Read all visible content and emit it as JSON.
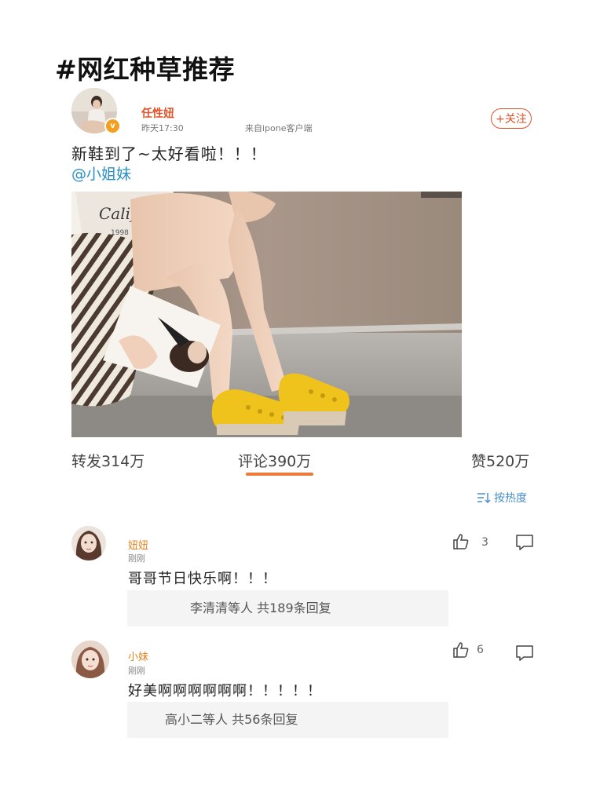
{
  "hashtag": "#网红种草推荐",
  "post": {
    "author": "任性妞",
    "verified_badge": "v",
    "time": "昨天17:30",
    "source": "来自ipone客户端",
    "follow_label": "+关注",
    "text": "新鞋到了~太好看啦！！！",
    "mention": "@小姐妹",
    "image_shirt_text": "Califor",
    "image_shirt_year": "1998",
    "stats": {
      "repost": "转发314万",
      "comment": "评论390万",
      "like": "赞520万"
    },
    "sort_label": "按热度"
  },
  "comments": [
    {
      "name": "妞妞",
      "time": "刚刚",
      "text": "哥哥节日快乐啊！！！",
      "likes": "3",
      "replies": "李清清等人 共189条回复"
    },
    {
      "name": "小妹",
      "time": "刚刚",
      "text": "好美啊啊啊啊啊啊！！！！！",
      "likes": "6",
      "replies": "高小二等人 共56条回复"
    }
  ],
  "colors": {
    "accent": "#e2522a",
    "link": "#2a8fc4",
    "tab_underline": "#ec7a3b",
    "comment_name": "#e6821e",
    "shoe_yellow": "#f0c21c"
  }
}
